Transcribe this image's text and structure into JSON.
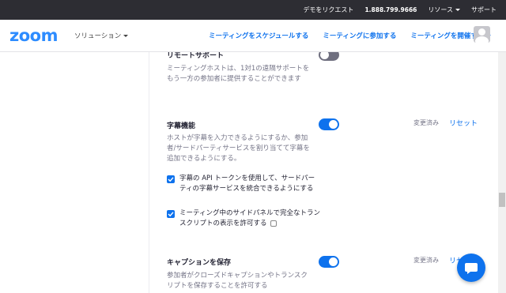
{
  "topbar": {
    "demo": "デモをリクエスト",
    "phone": "1.888.799.9666",
    "resources": "リソース",
    "support": "サポート"
  },
  "header": {
    "logo": "zoom",
    "solutions": "ソリューション",
    "nav": [
      "ミーティングをスケジュールする",
      "ミーティングに参加する",
      "ミーティングを開催する"
    ]
  },
  "settings": {
    "remote_support": {
      "title": "リモートサポート",
      "description": "ミーティングホストは、1対1の遠隔サポートをもう一方の参加者に提供することができます",
      "enabled": false
    },
    "captions": {
      "title": "字幕機能",
      "description": "ホストが字幕を入力できるようにするか、参加者/サードパーティサービスを割り当てて字幕を追加できるようにする。",
      "enabled": true,
      "changed": "変更済み",
      "reset": "リセット",
      "options": [
        {
          "label": "字幕の API トークンを使用して、サードパーティの字幕サービスを統合できるようにする",
          "checked": true
        },
        {
          "label": "ミーティング中のサイドパネルで完全なトランスクリプトの表示を許可する",
          "checked": true
        }
      ]
    },
    "save_captions": {
      "title": "キャプションを保存",
      "description": "参加者がクローズドキャプションやトランスクリプトを保存することを許可する",
      "enabled": true,
      "changed": "変更済み",
      "reset": "リセ"
    }
  },
  "colors": {
    "accent": "#0e72ed",
    "topbar": "#2d2d33",
    "logo": "#2d8cff"
  }
}
